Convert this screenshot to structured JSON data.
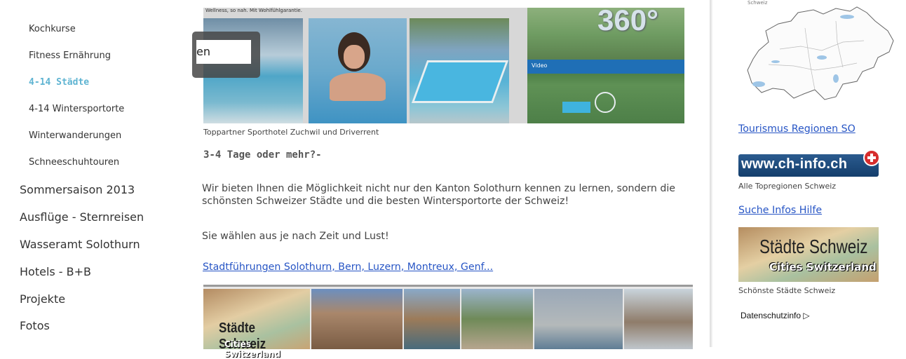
{
  "nav": {
    "sub_items": [
      {
        "label": "Kochkurse",
        "active": false
      },
      {
        "label": "Fitness Ernährung",
        "active": false
      },
      {
        "label": "4-14 Städte",
        "active": true
      },
      {
        "label": "4-14 Wintersportorte",
        "active": false
      },
      {
        "label": "Winterwanderungen",
        "active": false
      },
      {
        "label": "Schneeschuhtouren",
        "active": false
      }
    ],
    "top_items": [
      {
        "label": "Sommersaison 2013"
      },
      {
        "label": "Ausflüge - Sternreisen"
      },
      {
        "label": "Wasseramt Solothurn"
      },
      {
        "label": "Hotels - B+B"
      },
      {
        "label": "Projekte"
      },
      {
        "label": "Fotos"
      }
    ]
  },
  "banner": {
    "tagline": "Wellness, so nah. Mit Wohlfühlgarantie.",
    "badge_360": "360°",
    "video_label": "Video"
  },
  "search": {
    "value": "en"
  },
  "main": {
    "caption": "Toppartner Sporthotel Zuchwil und Driverrent",
    "heading": "3-4 Tage oder mehr?-",
    "para1": "Wir bieten Ihnen die Möglichkeit nicht nur den Kanton Solothurn kennen zu lernen, sondern die schönsten Schweizer Städte und die besten Wintersportorte der Schweiz!",
    "para2": "Sie wählen aus je nach Zeit und Lust!",
    "link": "Stadtführungen Solothurn, Bern, Luzern, Montreux, Genf...",
    "strip_title": "Städte Schweiz",
    "strip_subtitle": "Cities Switzerland"
  },
  "right": {
    "map_label": "Schweiz",
    "link_tourismus": "Tourismus Regionen SO",
    "chinfo_logo": "www.ch-info.ch",
    "chinfo_caption": "Alle Topregionen Schweiz",
    "link_suche": "Suche Infos Hilfe",
    "staedte_title": "Städte Schweiz",
    "staedte_subtitle": "Cities Switzerland",
    "staedte_caption": "Schönste Städte Schweiz",
    "privacy": "Datenschutzinfo ▷"
  },
  "colors": {
    "active_nav": "#5fb4d2",
    "link": "#2755c5",
    "text": "#444444"
  }
}
